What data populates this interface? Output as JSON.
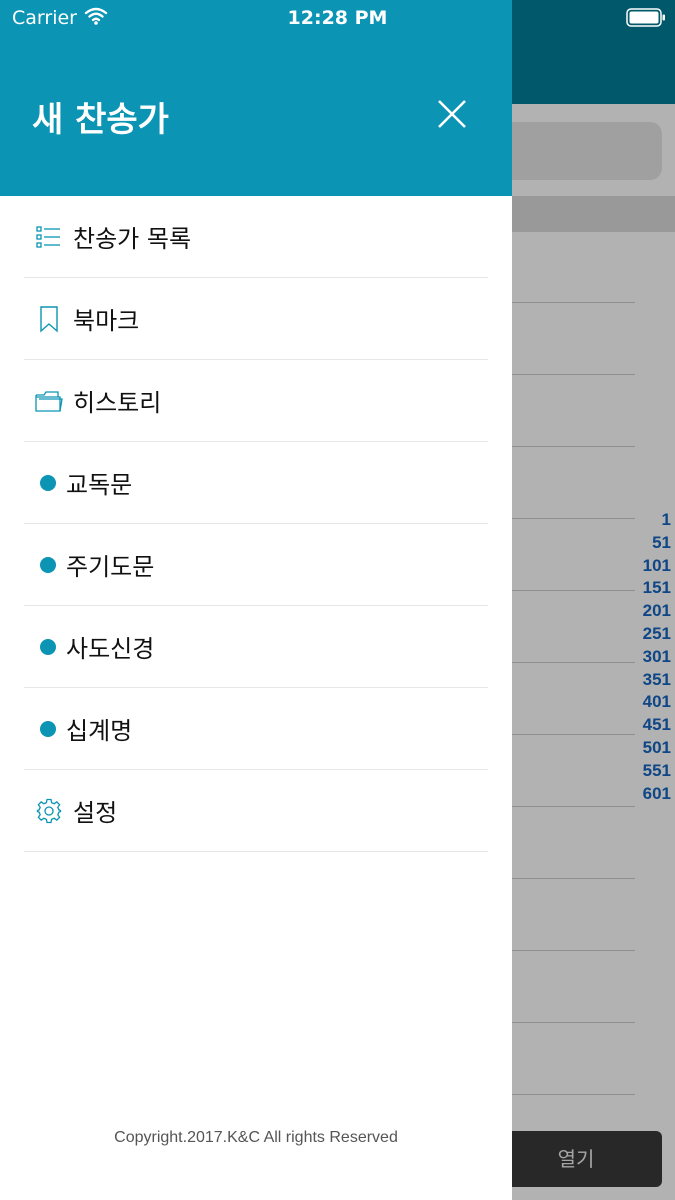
{
  "status_bar": {
    "carrier": "Carrier",
    "time": "12:28 PM"
  },
  "drawer": {
    "title": "새 찬송가",
    "menu": [
      {
        "label": "찬송가 목록",
        "icon": "list-icon"
      },
      {
        "label": "북마크",
        "icon": "bookmark-icon"
      },
      {
        "label": "히스토리",
        "icon": "folder-icon"
      },
      {
        "label": "교독문",
        "icon": "dot"
      },
      {
        "label": "주기도문",
        "icon": "dot"
      },
      {
        "label": "사도신경",
        "icon": "dot"
      },
      {
        "label": "십계명",
        "icon": "dot"
      },
      {
        "label": "설정",
        "icon": "gear-icon"
      }
    ],
    "copyright": "Copyright.2017.K&C All rights Reserved"
  },
  "main": {
    "index": [
      "1",
      "51",
      "101",
      "151",
      "201",
      "251",
      "301",
      "351",
      "401",
      "451",
      "501",
      "551",
      "601"
    ],
    "open_button": "열기"
  },
  "colors": {
    "accent": "#0b94b3",
    "index_text": "#1565c0"
  }
}
